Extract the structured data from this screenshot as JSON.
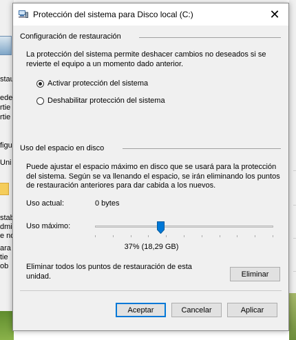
{
  "background": {
    "left_fragments": [
      "staura",
      "ede",
      "rtie",
      "rtie",
      "figu",
      "Uni",
      "stab",
      "dmi",
      "e no",
      "ara",
      "tie",
      "ob"
    ]
  },
  "dialog": {
    "title": "Protección del sistema para Disco local (C:)",
    "close_glyph": "✕",
    "restore_group": {
      "header": "Configuración de restauración",
      "description": "La protección del sistema permite deshacer cambios no deseados si se revierte el equipo a un momento dado anterior.",
      "options": [
        {
          "label": "Activar protección del sistema",
          "selected": true
        },
        {
          "label": "Deshabilitar protección del sistema",
          "selected": false
        }
      ]
    },
    "disk_group": {
      "header": "Uso del espacio en disco",
      "description": "Puede ajustar el espacio máximo en disco que se usará para la protección del sistema. Según se va llenando el espacio, se irán eliminando los puntos de restauración anteriores para dar cabida a los nuevos.",
      "current_usage_label": "Uso actual:",
      "current_usage_value": "0 bytes",
      "max_usage_label": "Uso máximo:",
      "max_usage_fraction": 0.37,
      "max_usage_text": "37% (18,29 GB)",
      "delete_text": "Eliminar todos los puntos de restauración de esta unidad.",
      "delete_button": "Eliminar"
    },
    "buttons": {
      "ok": "Aceptar",
      "cancel": "Cancelar",
      "apply": "Aplicar"
    },
    "colors": {
      "accent": "#0078d7",
      "window_bg": "#f0f0f0"
    }
  }
}
